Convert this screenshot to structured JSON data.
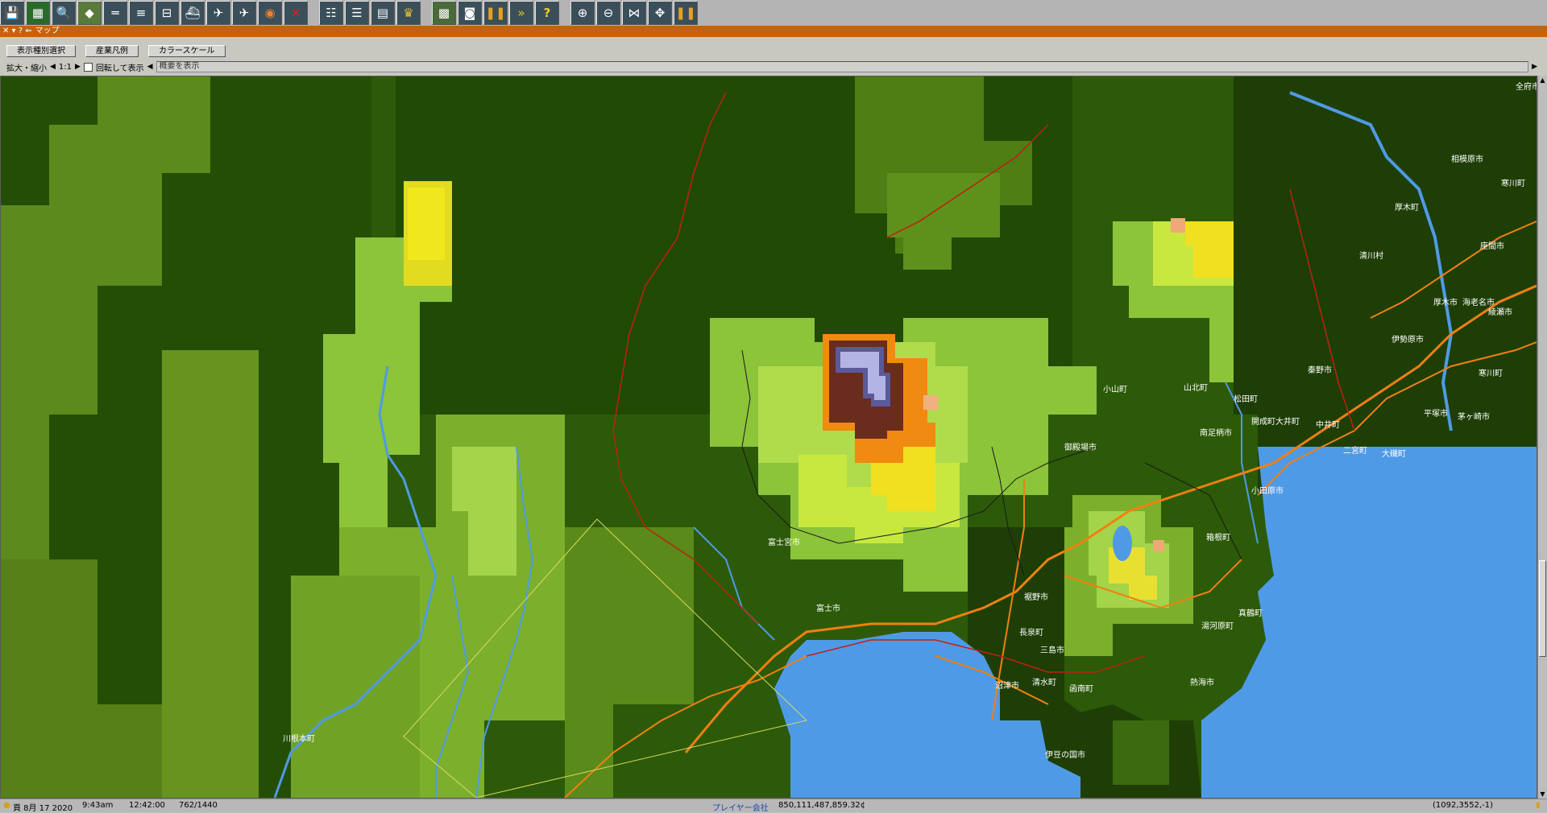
{
  "window": {
    "title": "マップ",
    "title_controls": "✕ ▾ ? ⇐"
  },
  "header": {
    "buttons": [
      "表示種別選択",
      "産業凡例",
      "カラースケール"
    ],
    "zoom_label": "拡大・縮小",
    "zoom_value": "1:1",
    "rotate_label": "回転して表示",
    "overview_label": "概要を表示"
  },
  "map_labels": [
    {
      "text": "全府市"
    },
    {
      "text": "相模原市"
    },
    {
      "text": "厚木町"
    },
    {
      "text": "寒川町"
    },
    {
      "text": "座間市"
    },
    {
      "text": "清川村"
    },
    {
      "text": "厚木市"
    },
    {
      "text": "海老名市"
    },
    {
      "text": "綾瀬市"
    },
    {
      "text": "伊勢原市"
    },
    {
      "text": "秦野市"
    },
    {
      "text": "寒川町"
    },
    {
      "text": "山北町"
    },
    {
      "text": "松田町"
    },
    {
      "text": "小山町"
    },
    {
      "text": "開成町大井町"
    },
    {
      "text": "中井町"
    },
    {
      "text": "平塚市"
    },
    {
      "text": "茅ヶ崎市"
    },
    {
      "text": "南足柄市"
    },
    {
      "text": "二宮町"
    },
    {
      "text": "大磯町"
    },
    {
      "text": "御殿場市"
    },
    {
      "text": "小田原市"
    },
    {
      "text": "箱根町"
    },
    {
      "text": "富士宮市"
    },
    {
      "text": "富士市"
    },
    {
      "text": "裾野市"
    },
    {
      "text": "真鶴町"
    },
    {
      "text": "湯河原町"
    },
    {
      "text": "長泉町"
    },
    {
      "text": "三島市"
    },
    {
      "text": "沼津市"
    },
    {
      "text": "清水町"
    },
    {
      "text": "函南町"
    },
    {
      "text": "熱海市"
    },
    {
      "text": "伊豆の国市"
    },
    {
      "text": "川根本町"
    }
  ],
  "status": {
    "date": "頁 8月 17 2020",
    "time": "9:43am",
    "clock": "12:42:00",
    "coords_page": "762/1440",
    "company": "プレイヤー会社",
    "money": "850,111,487,859.32¢",
    "position": "(1092,3552,-1)"
  },
  "colors": {
    "titlebar": "#c4620e",
    "water": "#4f9ae6",
    "road": "#f08010",
    "rail": "#c02010"
  },
  "toolbar_icons": [
    "save-icon",
    "minimap-icon",
    "zoom-query-icon",
    "terrain-icon",
    "rail-icon",
    "road-icon",
    "tram-icon",
    "ship-icon",
    "airport-icon",
    "air-icon",
    "stop-icon",
    "remove-icon",
    "schedule-icon",
    "list-icon",
    "finance-icon",
    "trophy-icon",
    "map-icon",
    "screenshot-icon",
    "pause-icon",
    "fastforward-icon",
    "help-icon",
    "zoom-in-icon",
    "zoom-out-icon",
    "grid-icon",
    "compass-icon",
    "pause-small-icon"
  ]
}
